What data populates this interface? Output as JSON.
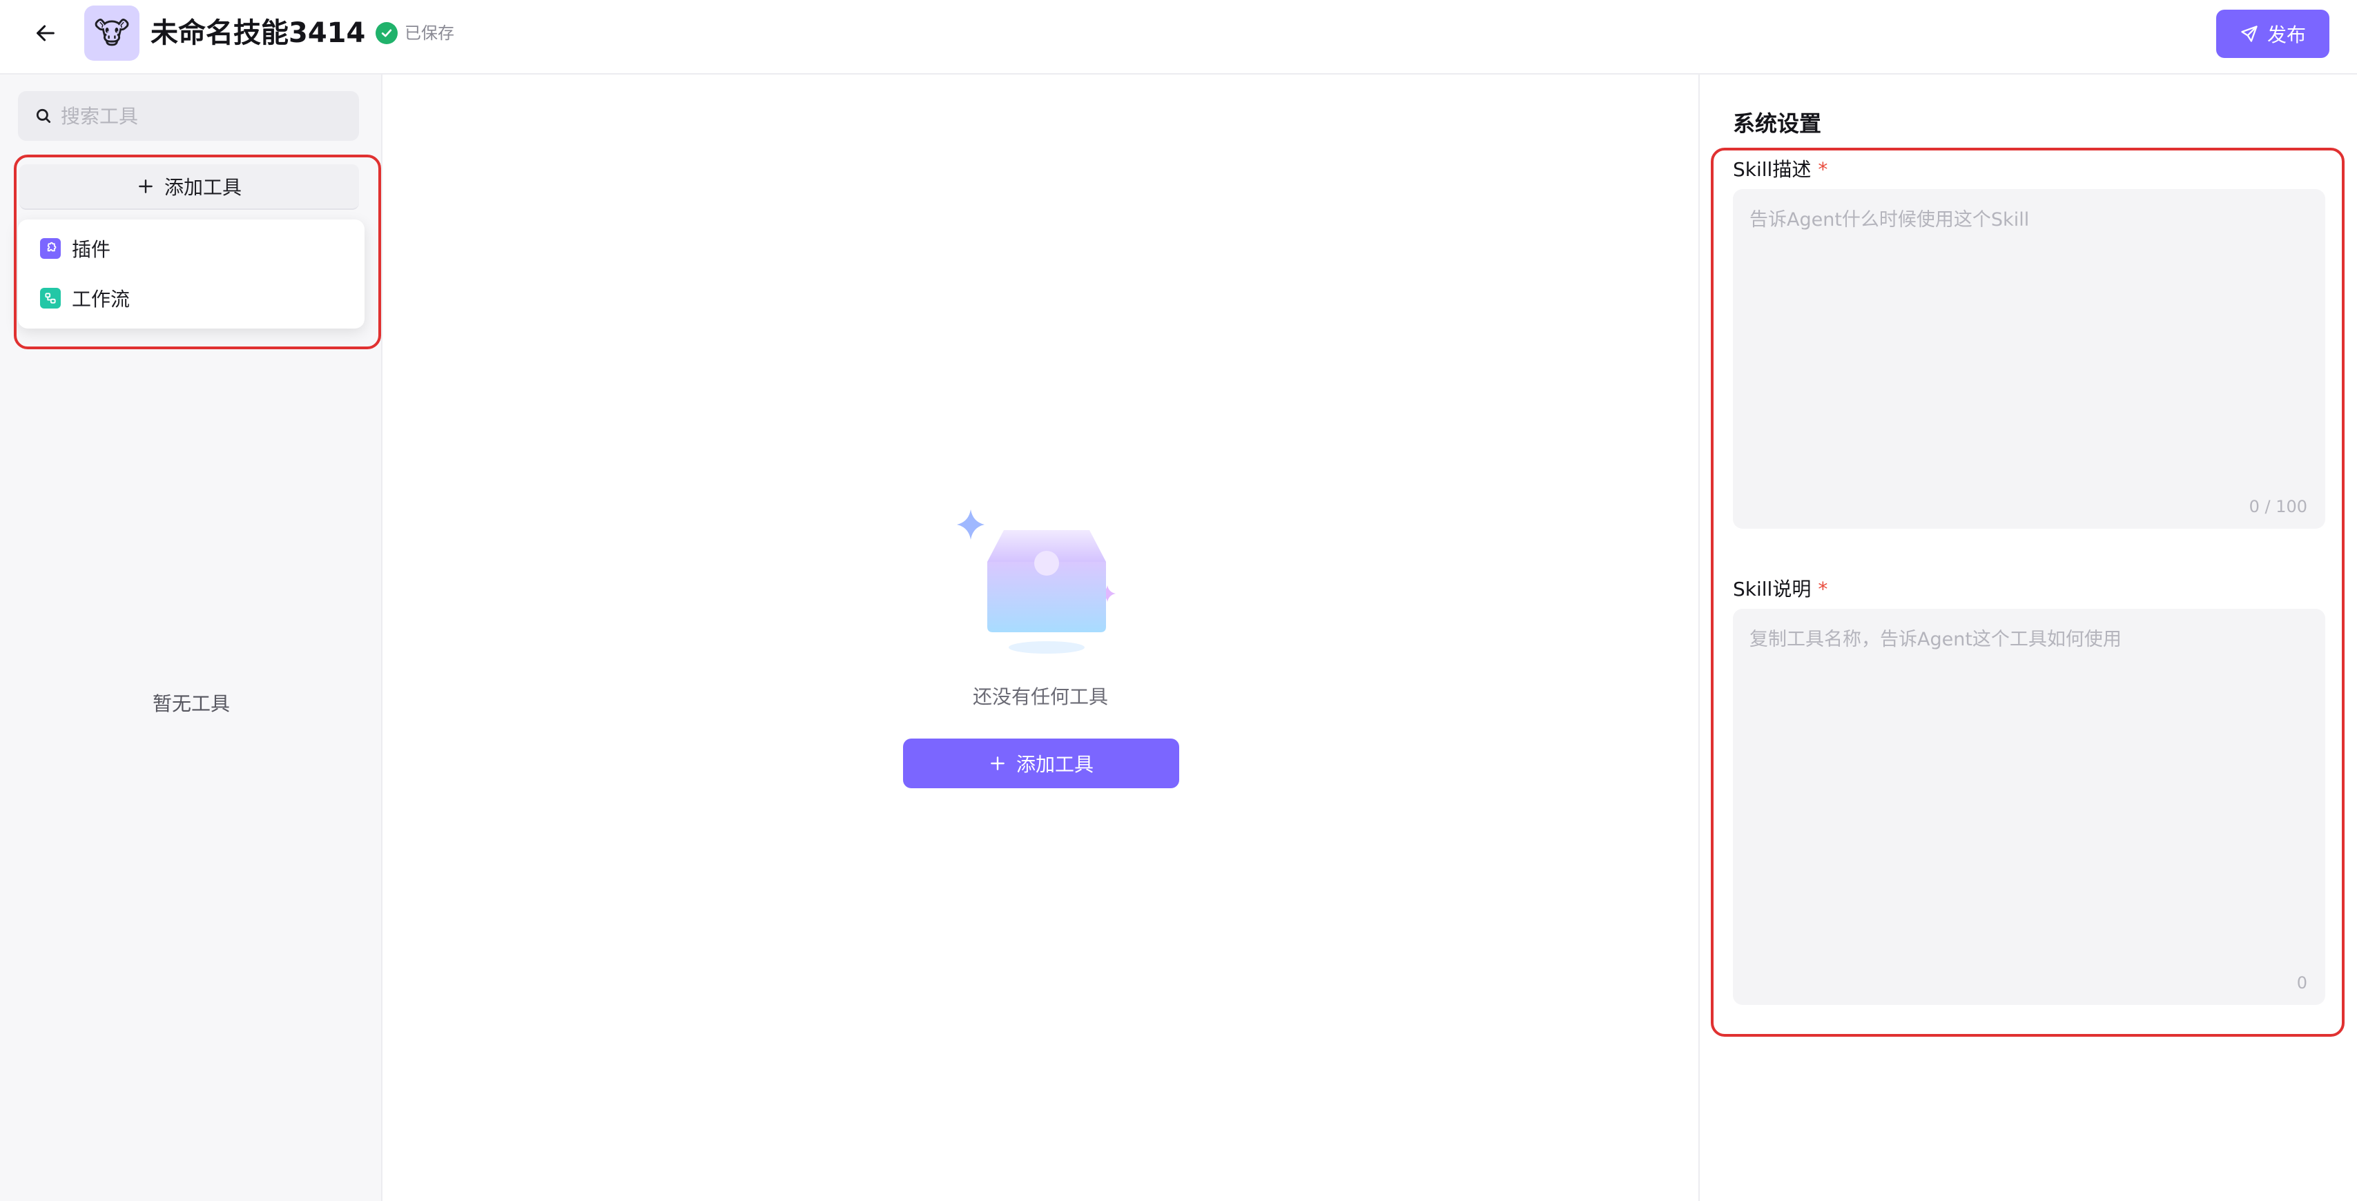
{
  "header": {
    "title": "未命名技能3414",
    "saved_status": "已保存",
    "publish_label": "发布",
    "avatar_emoji": "🐮"
  },
  "sidebar": {
    "search_placeholder": "搜索工具",
    "add_tool_label": "添加工具",
    "dropdown_items": [
      {
        "label": "插件",
        "icon": "plugin-icon",
        "color": "#7b66ff"
      },
      {
        "label": "工作流",
        "icon": "workflow-icon",
        "color": "#22c7a6"
      }
    ],
    "empty_text": "暂无工具"
  },
  "center": {
    "empty_text": "还没有任何工具",
    "add_tool_label": "添加工具"
  },
  "settings": {
    "title": "系统设置",
    "fields": [
      {
        "label": "Skill描述",
        "required_mark": "*",
        "placeholder": "告诉Agent什么时候使用这个Skill",
        "counter": "0 / 100"
      },
      {
        "label": "Skill说明",
        "required_mark": "*",
        "placeholder": "复制工具名称，告诉Agent这个工具如何使用",
        "counter": "0"
      }
    ]
  },
  "colors": {
    "accent": "#7b66ff",
    "saved_green": "#20b26b",
    "highlight_red": "#e03131"
  }
}
